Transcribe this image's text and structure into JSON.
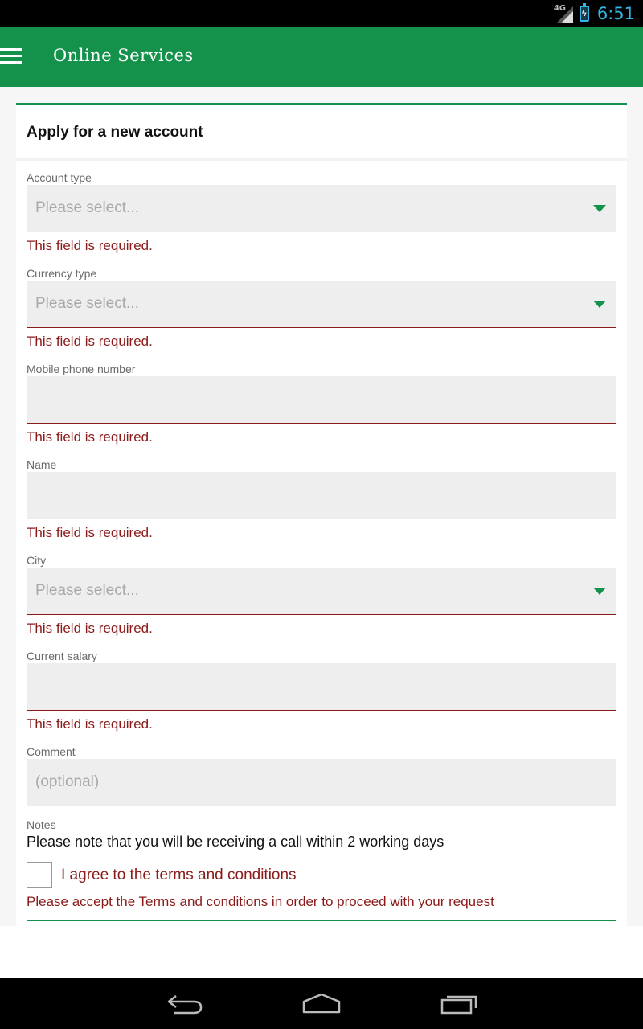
{
  "status_bar": {
    "network": "4G",
    "time": "6:51"
  },
  "app_bar": {
    "title": "Online Services"
  },
  "card": {
    "title": "Apply for a new account"
  },
  "form": {
    "account_type": {
      "label": "Account type",
      "placeholder": "Please select...",
      "error": "This field is required."
    },
    "currency_type": {
      "label": "Currency type",
      "placeholder": "Please select...",
      "error": "This field is required."
    },
    "mobile_phone": {
      "label": "Mobile phone number",
      "value": "",
      "error": "This field is required."
    },
    "name": {
      "label": "Name",
      "value": "",
      "error": "This field is required."
    },
    "city": {
      "label": "City",
      "placeholder": "Please select...",
      "error": "This field is required."
    },
    "current_salary": {
      "label": "Current salary",
      "value": "",
      "error": "This field is required."
    },
    "comment": {
      "label": "Comment",
      "placeholder": "(optional)"
    },
    "notes": {
      "label": "Notes",
      "text": "Please note that you will be receiving a call within 2 working days"
    },
    "terms": {
      "label": "I agree to the terms and conditions",
      "checked": false,
      "error": "Please accept the Terms and conditions in order to proceed with your request"
    }
  },
  "colors": {
    "brand_green": "#14924b",
    "error_red": "#8b1a1a",
    "status_blue": "#33b5e5"
  },
  "nav_bar": {
    "buttons": [
      "back-icon",
      "home-icon",
      "recent-apps-icon"
    ]
  }
}
